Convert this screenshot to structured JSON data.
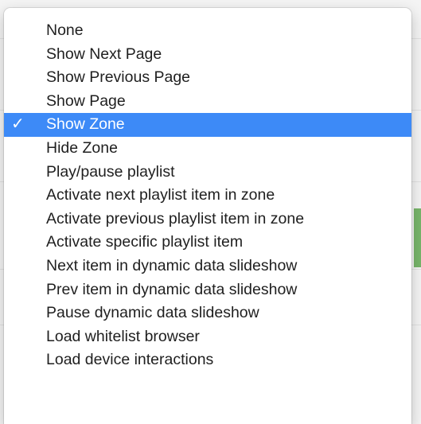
{
  "menu": {
    "selected_index": 4,
    "check_glyph": "✓",
    "accent_color": "#3d8af7",
    "items": [
      {
        "label": "None"
      },
      {
        "label": "Show Next Page"
      },
      {
        "label": "Show Previous Page"
      },
      {
        "label": "Show Page"
      },
      {
        "label": "Show Zone"
      },
      {
        "label": "Hide Zone"
      },
      {
        "label": "Play/pause playlist"
      },
      {
        "label": "Activate next playlist item in zone"
      },
      {
        "label": "Activate previous playlist item in zone"
      },
      {
        "label": "Activate specific playlist item"
      },
      {
        "label": "Next item in dynamic data slideshow"
      },
      {
        "label": "Prev item in dynamic data slideshow"
      },
      {
        "label": "Pause dynamic data slideshow"
      },
      {
        "label": "Load whitelist browser"
      },
      {
        "label": "Load device interactions"
      }
    ]
  },
  "background": {
    "accent_green": "#77b56a"
  }
}
